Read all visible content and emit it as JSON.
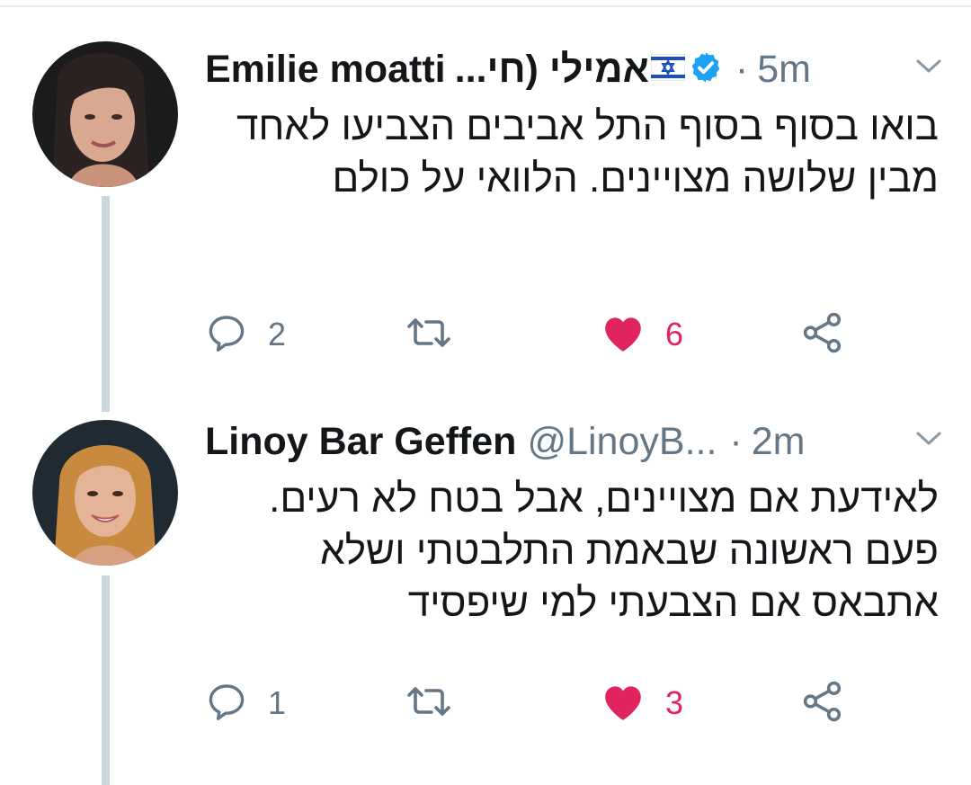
{
  "colors": {
    "text": "#14171a",
    "muted": "#657786",
    "like": "#e0245e",
    "verified": "#1da1f2",
    "thread_line": "#ccd6dd"
  },
  "tweets": [
    {
      "author_name": "Emilie moatti",
      "author_name_hebrew": "אמילי (חי...",
      "has_flag": true,
      "verified": true,
      "dot": "·",
      "time": "5m",
      "text": "בואו בסוף בסוף התל אביבים הצביעו לאחד מבין שלושה מצויינים. הלוואי על כולם",
      "replies": "2",
      "likes": "6",
      "liked": true
    },
    {
      "author_name": "Linoy Bar Geffen",
      "handle": "@LinoyB...",
      "dot": "·",
      "time": "2m",
      "text": "לאידעת אם מצויינים, אבל בטח לא רעים. פעם ראשונה שבאמת התלבטתי ושלא אתבאס אם הצבעתי למי שיפסיד",
      "replies": "1",
      "likes": "3",
      "liked": true
    }
  ],
  "icons": {
    "reply": "reply-icon",
    "retweet": "retweet-icon",
    "like": "heart-icon",
    "share": "share-icon",
    "more": "chevron-down-icon",
    "verified": "verified-badge-icon",
    "flag": "israel-flag-icon"
  }
}
